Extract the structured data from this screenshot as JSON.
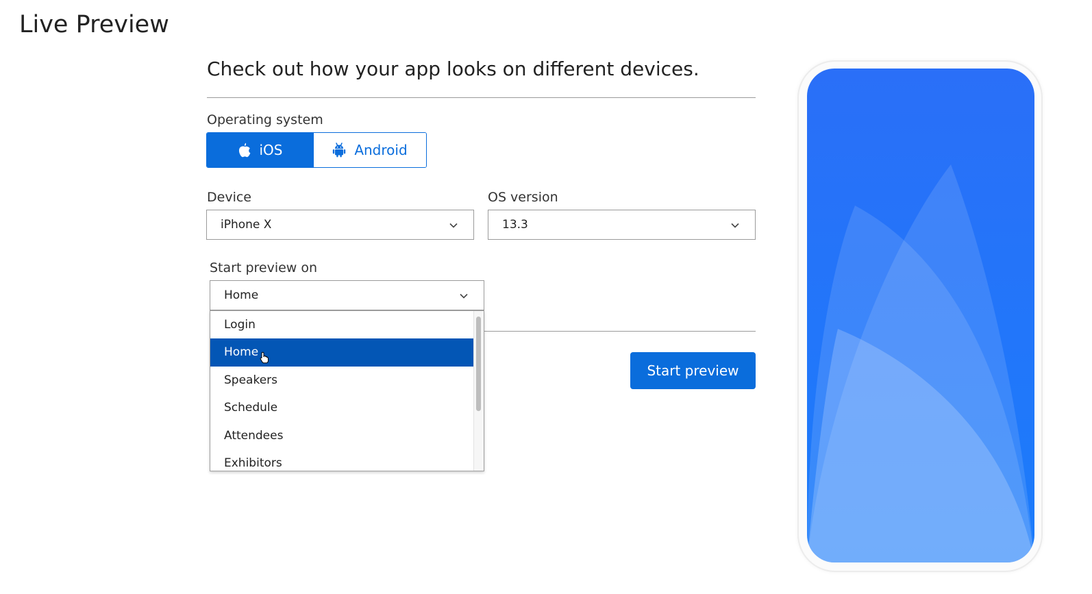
{
  "page": {
    "title": "Live Preview",
    "subtitle": "Check out how your app looks on different devices."
  },
  "os": {
    "label": "Operating system",
    "options": [
      {
        "label": "iOS",
        "icon": "apple-icon",
        "selected": true
      },
      {
        "label": "Android",
        "icon": "android-icon",
        "selected": false
      }
    ]
  },
  "device": {
    "label": "Device",
    "value": "iPhone X"
  },
  "os_version": {
    "label": "OS version",
    "value": "13.3"
  },
  "start_preview_on": {
    "label": "Start preview on",
    "value": "Home",
    "options": [
      "Login",
      "Home",
      "Speakers",
      "Schedule",
      "Attendees",
      "Exhibitors"
    ],
    "highlighted": "Home"
  },
  "actions": {
    "start_preview_label": "Start preview"
  },
  "colors": {
    "primary": "#0a6ddc",
    "selected_option": "#0356b5",
    "phone_gradient_top": "#2a6ff8",
    "phone_gradient_bottom": "#6aa8ff"
  }
}
